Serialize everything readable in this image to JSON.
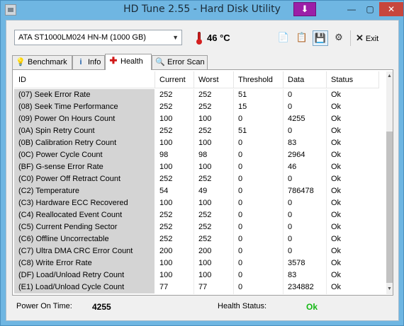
{
  "window": {
    "title": "HD Tune 2.55 - Hard Disk Utility",
    "controls": {
      "minimize": "—",
      "maximize": "▢",
      "close": "✕"
    }
  },
  "toolbar": {
    "drive": "ATA    ST1000LM024 HN-M (1000 GB)",
    "temperature": "46 °C",
    "exit_label": "Exit",
    "icons": [
      "copy-text-icon",
      "copy-screenshot-icon",
      "save-icon",
      "options-icon"
    ]
  },
  "tabs": [
    {
      "label": "Benchmark",
      "icon": "lightbulb-icon"
    },
    {
      "label": "Info",
      "icon": "info-icon"
    },
    {
      "label": "Health",
      "icon": "red-cross-icon",
      "active": true
    },
    {
      "label": "Error Scan",
      "icon": "magnifier-icon"
    }
  ],
  "table": {
    "columns": [
      "ID",
      "Current",
      "Worst",
      "Threshold",
      "Data",
      "Status"
    ],
    "rows": [
      [
        "(07) Seek Error Rate",
        "252",
        "252",
        "51",
        "0",
        "Ok"
      ],
      [
        "(08) Seek Time Performance",
        "252",
        "252",
        "15",
        "0",
        "Ok"
      ],
      [
        "(09) Power On Hours Count",
        "100",
        "100",
        "0",
        "4255",
        "Ok"
      ],
      [
        "(0A) Spin Retry Count",
        "252",
        "252",
        "51",
        "0",
        "Ok"
      ],
      [
        "(0B) Calibration Retry Count",
        "100",
        "100",
        "0",
        "83",
        "Ok"
      ],
      [
        "(0C) Power Cycle Count",
        "98",
        "98",
        "0",
        "2964",
        "Ok"
      ],
      [
        "(BF) G-sense Error Rate",
        "100",
        "100",
        "0",
        "46",
        "Ok"
      ],
      [
        "(C0) Power Off Retract Count",
        "252",
        "252",
        "0",
        "0",
        "Ok"
      ],
      [
        "(C2) Temperature",
        "54",
        "49",
        "0",
        "786478",
        "Ok"
      ],
      [
        "(C3) Hardware ECC Recovered",
        "100",
        "100",
        "0",
        "0",
        "Ok"
      ],
      [
        "(C4) Reallocated Event Count",
        "252",
        "252",
        "0",
        "0",
        "Ok"
      ],
      [
        "(C5) Current Pending Sector",
        "252",
        "252",
        "0",
        "0",
        "Ok"
      ],
      [
        "(C6) Offline Uncorrectable",
        "252",
        "252",
        "0",
        "0",
        "Ok"
      ],
      [
        "(C7) Ultra DMA CRC Error Count",
        "200",
        "200",
        "0",
        "0",
        "Ok"
      ],
      [
        "(C8) Write Error Rate",
        "100",
        "100",
        "0",
        "3578",
        "Ok"
      ],
      [
        "(DF) Load/Unload Retry Count",
        "100",
        "100",
        "0",
        "83",
        "Ok"
      ],
      [
        "(E1) Load/Unload Cycle Count",
        "77",
        "77",
        "0",
        "234882",
        "Ok"
      ]
    ]
  },
  "status": {
    "power_on_label": "Power On Time:",
    "power_on_value": "4255",
    "health_label": "Health Status:",
    "health_value": "Ok",
    "health_color": "#14b814"
  }
}
